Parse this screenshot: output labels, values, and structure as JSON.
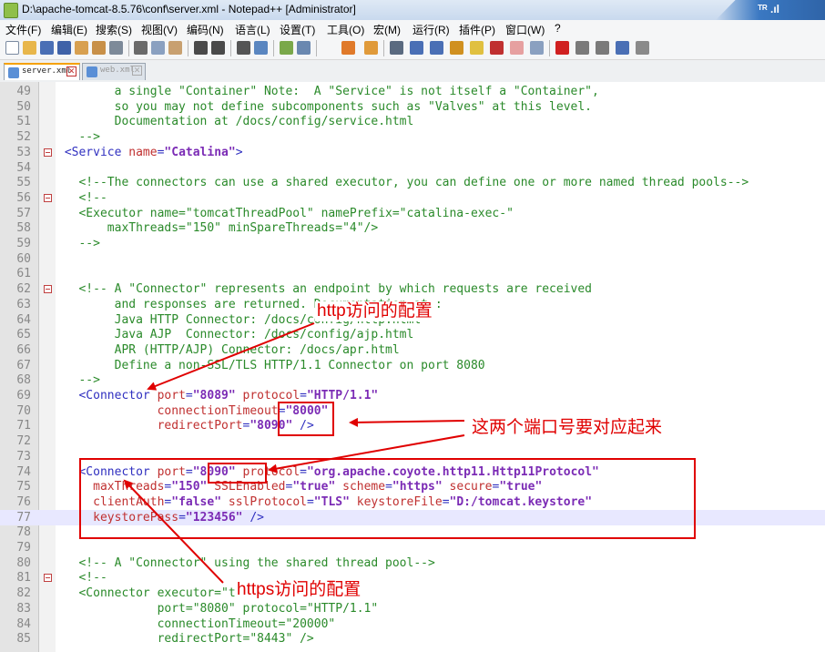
{
  "window": {
    "title": "D:\\apache-tomcat-8.5.76\\conf\\server.xml - Notepad++ [Administrator]",
    "tray_indicator": "ᵀᴿ .ıl"
  },
  "menu": [
    "文件(F)",
    "编辑(E)",
    "搜索(S)",
    "视图(V)",
    "编码(N)",
    "语言(L)",
    "设置(T)",
    "工具(O)",
    "宏(M)",
    "运行(R)",
    "插件(P)",
    "窗口(W)",
    "?"
  ],
  "tabs": [
    {
      "label": "server.xml",
      "active": true,
      "close": "✕"
    },
    {
      "label": "web.xml",
      "active": false,
      "close": "✕"
    }
  ],
  "editor": {
    "lines": [
      {
        "n": "49",
        "text": "        a single \"Container\" Note:  A \"Service\" is not itself a \"Container\","
      },
      {
        "n": "50",
        "text": "        so you may not define subcomponents such as \"Valves\" at this level."
      },
      {
        "n": "51",
        "text": "        Documentation at /docs/config/service.html"
      },
      {
        "n": "52",
        "text": "   -->"
      },
      {
        "n": "53",
        "text": " <Service name=\"Catalina\">"
      },
      {
        "n": "54",
        "text": ""
      },
      {
        "n": "55",
        "text": "   <!--The connectors can use a shared executor, you can define one or more named thread pools-->"
      },
      {
        "n": "56",
        "text": "   <!--"
      },
      {
        "n": "57",
        "text": "   <Executor name=\"tomcatThreadPool\" namePrefix=\"catalina-exec-\""
      },
      {
        "n": "58",
        "text": "       maxThreads=\"150\" minSpareThreads=\"4\"/>"
      },
      {
        "n": "59",
        "text": "   -->"
      },
      {
        "n": "60",
        "text": ""
      },
      {
        "n": "61",
        "text": ""
      },
      {
        "n": "62",
        "text": "   <!-- A \"Connector\" represents an endpoint by which requests are received"
      },
      {
        "n": "63",
        "text": "        and responses are returned. Documentation at :"
      },
      {
        "n": "64",
        "text": "        Java HTTP Connector: /docs/config/http.html"
      },
      {
        "n": "65",
        "text": "        Java AJP  Connector: /docs/config/ajp.html"
      },
      {
        "n": "66",
        "text": "        APR (HTTP/AJP) Connector: /docs/apr.html"
      },
      {
        "n": "67",
        "text": "        Define a non-SSL/TLS HTTP/1.1 Connector on port 8080"
      },
      {
        "n": "68",
        "text": "   -->"
      },
      {
        "n": "69",
        "text": "   <Connector port=\"8089\" protocol=\"HTTP/1.1\""
      },
      {
        "n": "70",
        "text": "              connectionTimeout=\"8000\""
      },
      {
        "n": "71",
        "text": "              redirectPort=\"8090\" />"
      },
      {
        "n": "72",
        "text": ""
      },
      {
        "n": "73",
        "text": ""
      },
      {
        "n": "74",
        "text": "   <Connector port=\"8090\" protocol=\"org.apache.coyote.http11.Http11Protocol\""
      },
      {
        "n": "75",
        "text": "     maxThreads=\"150\" SSLEnabled=\"true\" scheme=\"https\" secure=\"true\""
      },
      {
        "n": "76",
        "text": "     clientAuth=\"false\" sslProtocol=\"TLS\" keystoreFile=\"D:/tomcat.keystore\""
      },
      {
        "n": "77",
        "text": "     keystorePass=\"123456\" />"
      },
      {
        "n": "78",
        "text": ""
      },
      {
        "n": "79",
        "text": ""
      },
      {
        "n": "80",
        "text": "   <!-- A \"Connector\" using the shared thread pool-->"
      },
      {
        "n": "81",
        "text": "   <!--"
      },
      {
        "n": "82",
        "text": "   <Connector executor=\"tomcatThreadPool\""
      },
      {
        "n": "83",
        "text": "              port=\"8080\" protocol=\"HTTP/1.1\""
      },
      {
        "n": "84",
        "text": "              connectionTimeout=\"20000\""
      },
      {
        "n": "85",
        "text": "              redirectPort=\"8443\" />"
      }
    ]
  },
  "annotations": {
    "http_label": "http访问的配置",
    "ports_label": "这两个端口号要对应起来",
    "https_label": "https访问的配置"
  },
  "colors": {
    "annotation": "#e00000",
    "comment": "#2a8a2a",
    "tag": "#3030c0",
    "attr": "#c03030",
    "value": "#7b2bb5"
  }
}
